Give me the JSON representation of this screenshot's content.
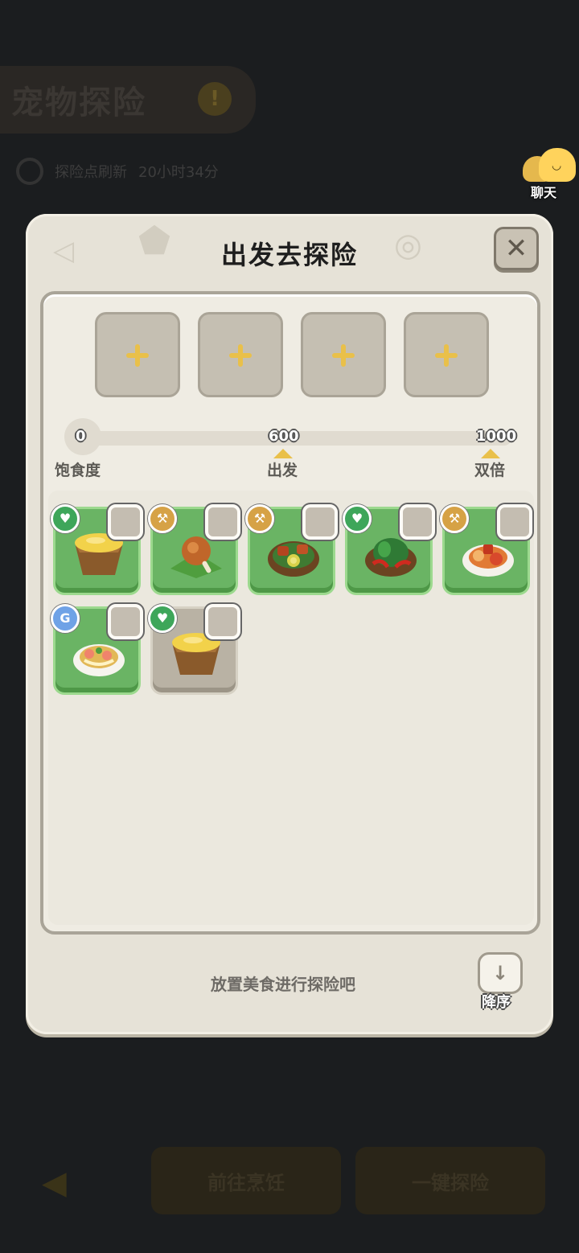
{
  "background": {
    "title": "宠物探险",
    "refresh_label": "探险点刷新",
    "refresh_time": "20小时34分",
    "buttons": [
      "前往烹饪",
      "一键探险"
    ]
  },
  "chat": {
    "label": "聊天"
  },
  "dialog": {
    "title": "出发去探险",
    "slots": [
      {
        "icon": "plus-icon"
      },
      {
        "icon": "plus-icon"
      },
      {
        "icon": "plus-icon"
      },
      {
        "icon": "plus-icon"
      }
    ],
    "satiety": {
      "current": 0,
      "max": 1000,
      "start_value": "0",
      "depart_value": "600",
      "double_value": "1000",
      "start_label": "饱食度",
      "depart_label": "出发",
      "double_label": "双倍"
    },
    "foods": [
      {
        "badge": "heart-icon",
        "dish": "cheese-bowl",
        "locked": false
      },
      {
        "badge": "axe-icon",
        "dish": "roast-chicken-leg",
        "locked": false
      },
      {
        "badge": "axe-icon",
        "dish": "meat-vegetable-stew",
        "locked": false
      },
      {
        "badge": "heart-icon",
        "dish": "pepper-greens-plate",
        "locked": false
      },
      {
        "badge": "axe-icon",
        "dish": "tomato-soup-plate",
        "locked": false
      },
      {
        "badge": "g-icon",
        "dish": "seafood-noodle-bowl",
        "locked": false
      },
      {
        "badge": "heart-icon",
        "dish": "cheese-bowl",
        "locked": true
      }
    ],
    "hint": "放置美食进行探险吧",
    "sort_label": "降序"
  }
}
